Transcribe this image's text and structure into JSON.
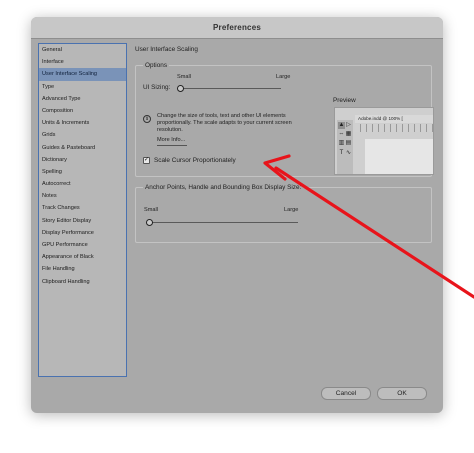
{
  "window": {
    "title": "Preferences"
  },
  "sidebar": {
    "items": [
      {
        "label": "General"
      },
      {
        "label": "Interface"
      },
      {
        "label": "User Interface Scaling"
      },
      {
        "label": "Type"
      },
      {
        "label": "Advanced Type"
      },
      {
        "label": "Composition"
      },
      {
        "label": "Units & Increments"
      },
      {
        "label": "Grids"
      },
      {
        "label": "Guides & Pasteboard"
      },
      {
        "label": "Dictionary"
      },
      {
        "label": "Spelling"
      },
      {
        "label": "Autocorrect"
      },
      {
        "label": "Notes"
      },
      {
        "label": "Track Changes"
      },
      {
        "label": "Story Editor Display"
      },
      {
        "label": "Display Performance"
      },
      {
        "label": "GPU Performance"
      },
      {
        "label": "Appearance of Black"
      },
      {
        "label": "File Handling"
      },
      {
        "label": "Clipboard Handling"
      }
    ],
    "selected_index": 2
  },
  "main": {
    "heading": "User Interface Scaling",
    "options": {
      "title": "Options",
      "ui_sizing_label": "UI Sizing:",
      "small_label": "Small",
      "large_label": "Large",
      "ui_sizing_value": 0,
      "info_icon_glyph": "i",
      "info_text": "Change the size of tools, text and other UI elements proportionally. The scale adapts to your current screen resolution.",
      "more_info_link": "More Info...",
      "checkbox_glyph": "✓",
      "scale_cursor_label": "Scale Cursor Proportionately",
      "scale_cursor_checked": true
    },
    "preview": {
      "title": "Preview",
      "doc_tab": "Adobe.indd @ 100% [",
      "tools": [
        "▲",
        "▷",
        "⇔",
        "▦",
        "▥",
        "▤",
        "T",
        "∿"
      ]
    },
    "anchor": {
      "title": "Anchor Points, Handle and Bounding Box Display Size:",
      "small_label": "Small",
      "large_label": "Large",
      "value": 0
    }
  },
  "buttons": {
    "cancel": "Cancel",
    "ok": "OK"
  },
  "annotation": {
    "arrow_color": "#e8141b"
  },
  "colors": {
    "window_bg": "#a9a9a9",
    "selection": "#7a93b8",
    "sidebar_border": "#4a72b0"
  },
  "icons": {
    "info": "info-icon",
    "checkbox": "checkmark-icon",
    "arrow": "red-arrow-annotation"
  }
}
